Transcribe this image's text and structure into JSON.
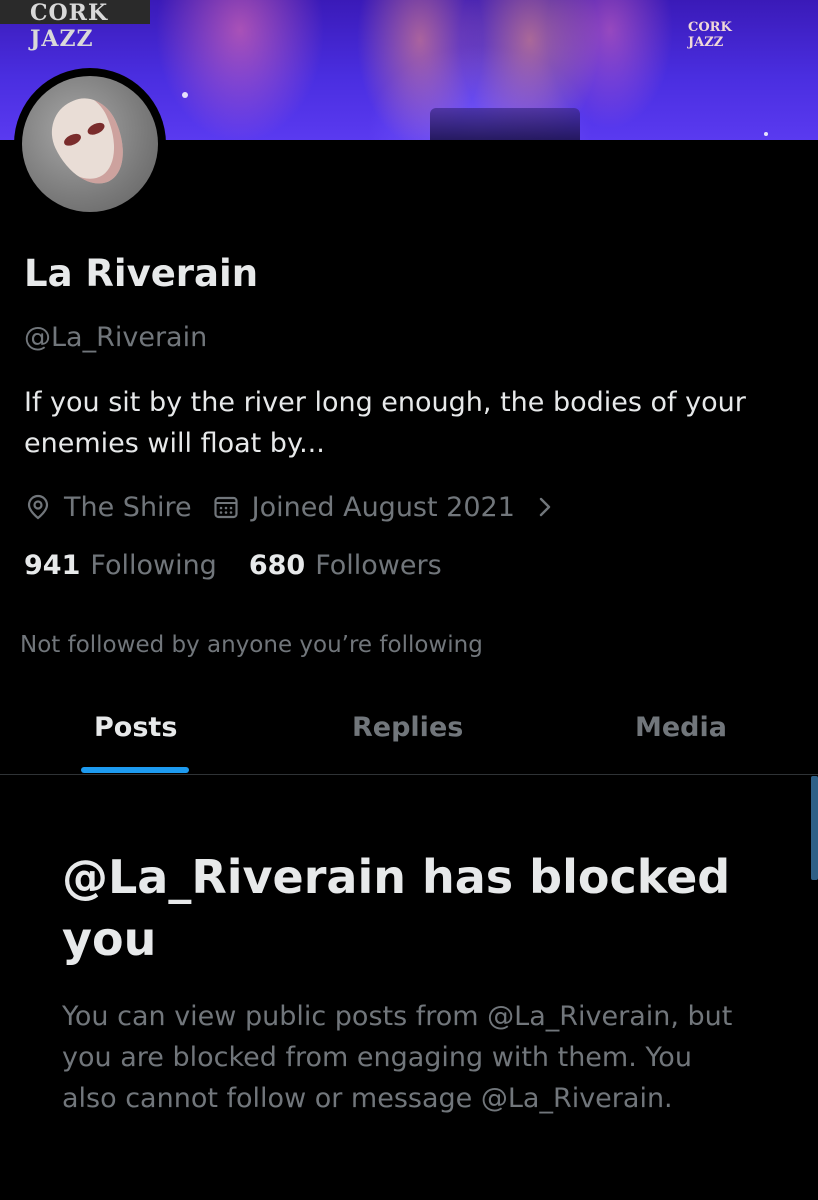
{
  "banner": {
    "sign_left_text": "CORK JAZZ",
    "sign_right_text": "CORK JAZZ"
  },
  "profile": {
    "display_name": "La Riverain",
    "handle": "@La_Riverain",
    "bio": "If you sit by the river long enough, the bodies of your enemies will float by...",
    "location": "The Shire",
    "joined": "Joined August 2021",
    "location_icon": "location-pin-icon",
    "calendar_icon": "calendar-icon",
    "following_count": "941",
    "following_label": "Following",
    "followers_count": "680",
    "followers_label": "Followers",
    "not_followed_text": "Not followed by anyone you’re following"
  },
  "tabs": [
    {
      "label": "Posts",
      "active": true
    },
    {
      "label": "Replies",
      "active": false
    },
    {
      "label": "Media",
      "active": false
    }
  ],
  "blocked": {
    "title": "@La_Riverain has blocked you",
    "body": "You can view public posts from @La_Riverain, but you are blocked from engaging with them. You also cannot follow or message @La_Riverain."
  },
  "colors": {
    "background": "#000000",
    "text_primary": "#e7e9ea",
    "text_secondary": "#71767b",
    "accent": "#1d9bf0"
  }
}
